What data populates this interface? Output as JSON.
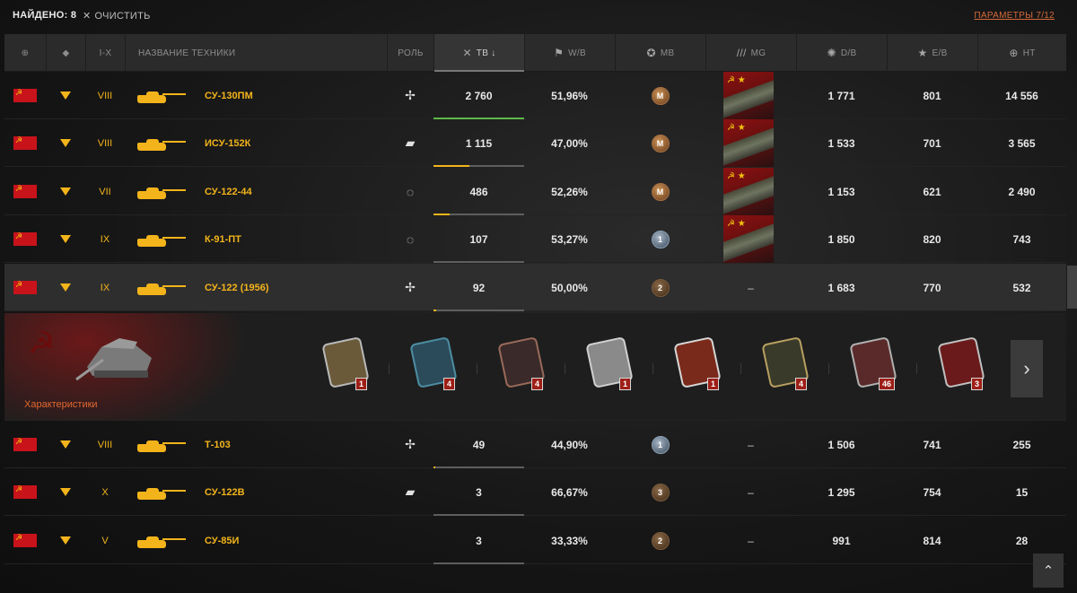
{
  "top": {
    "found": "НАЙДЕНО: 8",
    "clear": "ОЧИСТИТЬ",
    "params": "ПАРАМЕТРЫ 7/12"
  },
  "header": {
    "tier": "I-X",
    "name": "НАЗВАНИЕ ТЕХНИКИ",
    "role": "РОЛЬ",
    "tb": "ТВ ↓",
    "wb": "W/B",
    "mb": "MB",
    "mg": "MG",
    "db": "D/B",
    "eb": "E/B",
    "ht": "НТ"
  },
  "rows": [
    {
      "tier": "VIII",
      "name": "СУ-130ПМ",
      "role": "✢",
      "tb": "2 760",
      "wb": "51,96%",
      "medal": "M",
      "medal_kind": "gold",
      "mg": true,
      "db": "1 771",
      "eb": "801",
      "ht": "14 556",
      "bar": 1.0,
      "bar_color": "#5fb84a"
    },
    {
      "tier": "VIII",
      "name": "ИСУ-152К",
      "role": "▰",
      "tb": "1 115",
      "wb": "47,00%",
      "medal": "M",
      "medal_kind": "gold",
      "mg": true,
      "db": "1 533",
      "eb": "701",
      "ht": "3 565",
      "bar": 0.4,
      "bar_color": "#f3b41b"
    },
    {
      "tier": "VII",
      "name": "СУ-122-44",
      "role": "◌",
      "tb": "486",
      "wb": "52,26%",
      "medal": "M",
      "medal_kind": "gold",
      "mg": true,
      "db": "1 153",
      "eb": "621",
      "ht": "2 490",
      "bar": 0.18,
      "bar_color": "#f3b41b"
    },
    {
      "tier": "IX",
      "name": "К-91-ПТ",
      "role": "◌",
      "tb": "107",
      "wb": "53,27%",
      "medal": "1",
      "medal_kind": "m1",
      "mg": true,
      "db": "1 850",
      "eb": "820",
      "ht": "743",
      "bar": 0.0,
      "bar_color": "#f3b41b"
    },
    {
      "tier": "IX",
      "name": "СУ-122 (1956)",
      "role": "✢",
      "tb": "92",
      "wb": "50,00%",
      "medal": "2",
      "medal_kind": "m2",
      "mg": false,
      "mg_text": "–",
      "db": "1 683",
      "eb": "770",
      "ht": "532",
      "bar": 0.03,
      "bar_color": "#f3b41b"
    },
    {
      "tier": "VIII",
      "name": "Т-103",
      "role": "✢",
      "tb": "49",
      "wb": "44,90%",
      "medal": "1",
      "medal_kind": "m1",
      "mg": false,
      "mg_text": "–",
      "db": "1 506",
      "eb": "741",
      "ht": "255",
      "bar": 0.02,
      "bar_color": "#f3b41b"
    },
    {
      "tier": "X",
      "name": "СУ-122В",
      "role": "▰",
      "tb": "3",
      "wb": "66,67%",
      "medal": "3",
      "medal_kind": "m3",
      "mg": false,
      "mg_text": "–",
      "db": "1 295",
      "eb": "754",
      "ht": "15",
      "bar": 0.0,
      "bar_color": "#f3b41b"
    },
    {
      "tier": "V",
      "name": "СУ-85И",
      "role": "",
      "tb": "3",
      "wb": "33,33%",
      "medal": "2",
      "medal_kind": "m2",
      "mg": false,
      "mg_text": "–",
      "db": "991",
      "eb": "814",
      "ht": "28",
      "bar": 0.0,
      "bar_color": "#f3b41b"
    }
  ],
  "expanded": {
    "link": "Характеристики",
    "achievements": [
      {
        "count": "1",
        "color": "#6a5a3a",
        "border": "#b9b9b9"
      },
      {
        "count": "4",
        "color": "#2b4b5a",
        "border": "#4d8ea3"
      },
      {
        "count": "4",
        "color": "#3a2a2a",
        "border": "#9a6a5a"
      },
      {
        "count": "1",
        "color": "#8a8a8a",
        "border": "#d0d0d0"
      },
      {
        "count": "1",
        "color": "#7a2a1a",
        "border": "#d6d6d6"
      },
      {
        "count": "4",
        "color": "#3a3a2a",
        "border": "#b8a060"
      },
      {
        "count": "46",
        "color": "#5a2a2a",
        "border": "#b0b0b0"
      },
      {
        "count": "3",
        "color": "#6a1a1a",
        "border": "#c0c0c0"
      }
    ]
  }
}
